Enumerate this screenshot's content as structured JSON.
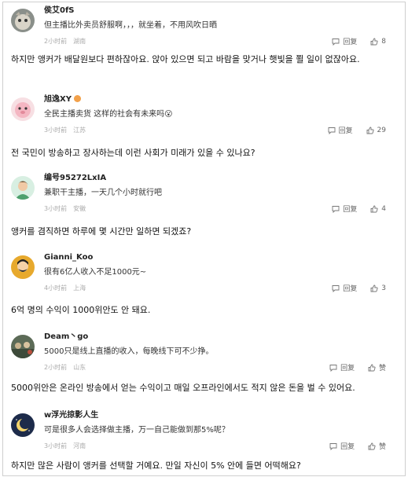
{
  "comments": [
    {
      "username": "侯艾0fS",
      "text": "但主播比外卖员舒服啊，，，就坐着，不用风吹日晒",
      "time": "2小时前",
      "location": "湖南",
      "reply_label": "回复",
      "likes": "8",
      "like_icon": "thumbs-up-icon",
      "reply_icon": "comment-bubble-icon"
    },
    {
      "username": "旭逸XY",
      "text": "全民主播卖货 这样的社会有未来吗😮",
      "time": "3小时前",
      "location": "江苏",
      "reply_label": "回复",
      "likes": "29",
      "like_icon": "thumbs-up-icon",
      "reply_icon": "comment-bubble-icon"
    },
    {
      "username": "编号95272LxIA",
      "text": "兼职干主播，一天几个小时就行吧",
      "time": "3小时前",
      "location": "安徽",
      "reply_label": "回复",
      "likes": "4",
      "like_icon": "thumbs-up-icon",
      "reply_icon": "comment-bubble-icon"
    },
    {
      "username": "Gianni_Koo",
      "text": "很有6亿人收入不足1000元~",
      "time": "4小时前",
      "location": "上海",
      "reply_label": "回复",
      "likes": "3",
      "like_icon": "thumbs-up-icon",
      "reply_icon": "comment-bubble-icon"
    },
    {
      "username": "Deam丶go",
      "text": "5000只是线上直播的收入，每晚线下可不少挣。",
      "time": "2小时前",
      "location": "山东",
      "reply_label": "回复",
      "likes": "赞",
      "like_icon": "thumbs-up-icon",
      "reply_icon": "comment-bubble-icon"
    },
    {
      "username": "w浮光掠影人生",
      "text": "可是很多人会选择做主播，万一自己能做到那5%呢？",
      "time": "3小时前",
      "location": "河南",
      "reply_label": "回复",
      "likes": "赞",
      "like_icon": "thumbs-up-icon",
      "reply_icon": "comment-bubble-icon"
    }
  ],
  "translations": [
    "하지만 앵커가 배달원보다 편하잖아요. 앉아 있으면 되고 바람을 맞거나 햇빛을 쬘 일이 없잖아요.",
    "전 국민이 방송하고 장사하는데 이런 사회가 미래가 있을 수 있나요?",
    "앵커를 겸직하면 하루에 몇 시간만 일하면 되겠죠?",
    "6억 명의 수익이 1000위안도 안 돼요.",
    "5000위안은 온라인 방송에서 얻는 수익이고 매일 오프라인에서도 적지 않은 돈을 벌 수 있어요.",
    "하지만 많은 사람이 앵커를 선택할 거예요. 만일 자신이 5% 안에 들면 어떡해요?"
  ]
}
